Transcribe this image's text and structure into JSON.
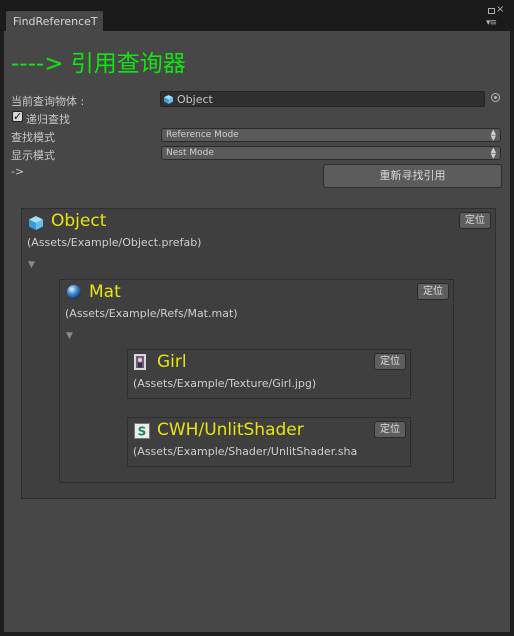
{
  "window": {
    "tab_label": "FindReferenceT",
    "controls": {
      "maximize_icon": "maximize-icon",
      "close_icon": "close-icon",
      "menu_icon": "context-menu-icon"
    }
  },
  "header": {
    "title": "----> 引用查询器"
  },
  "form": {
    "current_object_label": "当前查询物体 :",
    "current_object_value": "Object",
    "recursive_label": "递归查找",
    "recursive_checked": true,
    "find_mode_label": "查找模式",
    "find_mode_value": "Reference Mode",
    "display_mode_label": "显示模式",
    "display_mode_value": "Nest Mode",
    "arrow_text": "->",
    "refind_button": "重新寻找引用"
  },
  "results": {
    "root": {
      "name": "Object",
      "path": "(Assets/Example/Object.prefab)",
      "locate_label": "定位",
      "icon": "prefab-cube-icon"
    },
    "child": {
      "name": "Mat",
      "path": "(Assets/Example/Refs/Mat.mat)",
      "locate_label": "定位",
      "icon": "material-sphere-icon"
    },
    "grandchildren": [
      {
        "name": "Girl",
        "path": "(Assets/Example/Texture/Girl.jpg)",
        "locate_label": "定位",
        "icon": "texture-image-icon"
      },
      {
        "name": "CWH/UnlitShader",
        "path": "(Assets/Example/Shader/UnlitShader.sha",
        "locate_label": "定位",
        "icon": "shader-icon"
      }
    ]
  },
  "colors": {
    "title": "#12e512",
    "asset_name": "#e9e30f",
    "panel": "#474747"
  }
}
